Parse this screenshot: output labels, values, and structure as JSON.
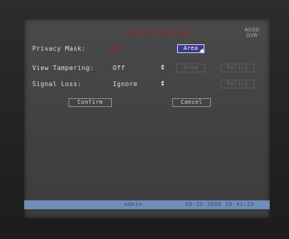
{
  "screen": {
    "title": "Advanced Settings",
    "logo_line1": "AOSD",
    "logo_line2": "DVR"
  },
  "rows": {
    "privacy_mask": {
      "label": "Privacy Mask:",
      "area_button": "Area"
    },
    "view_tampering": {
      "label": "View Tampering:",
      "value": "Off",
      "area_button": "Area",
      "policy_button": "Policy"
    },
    "signal_loss": {
      "label": "Signal Loss:",
      "value": "Ignore",
      "policy_button": "Policy"
    }
  },
  "buttons": {
    "confirm": "Confirm",
    "cancel": "Cancel"
  },
  "status": {
    "user": "admin",
    "datetime": "09-29-2009 10:41:25"
  },
  "colors": {
    "accent_red": "#a0211c",
    "status_bar": "#6f8fb8",
    "active_button": "#3b3b8a"
  }
}
